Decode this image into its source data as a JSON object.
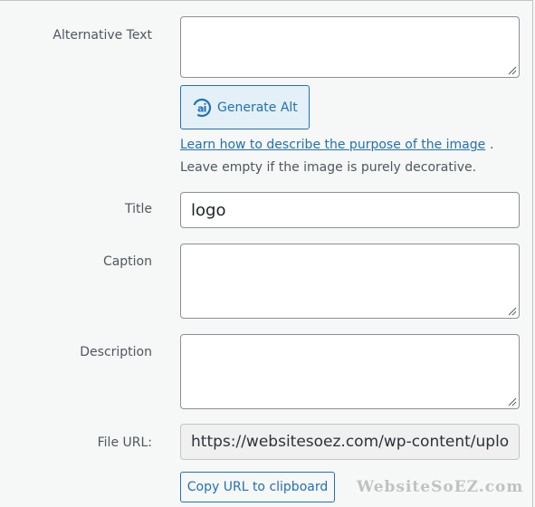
{
  "fields": {
    "alt_text": {
      "label": "Alternative Text",
      "value": ""
    },
    "title": {
      "label": "Title",
      "value": "logo"
    },
    "caption": {
      "label": "Caption",
      "value": ""
    },
    "description": {
      "label": "Description",
      "value": ""
    },
    "file_url": {
      "label": "File URL:",
      "value": "https://websitesoez.com/wp-content/uploads/"
    }
  },
  "generate_alt": {
    "label": "Generate Alt",
    "icon": "ai-icon"
  },
  "help": {
    "link_text": "Learn how to describe the purpose of the image",
    "period": ".",
    "note": "Leave empty if the image is purely decorative."
  },
  "copy_url_label": "Copy URL to clipboard",
  "watermark": "WebsiteSoEZ.com",
  "colors": {
    "accent": "#2271b1",
    "button_bg": "#e3f0f8",
    "label": "#50575e",
    "field_border": "#8c8f94",
    "page_bg": "#f6f7f7"
  }
}
